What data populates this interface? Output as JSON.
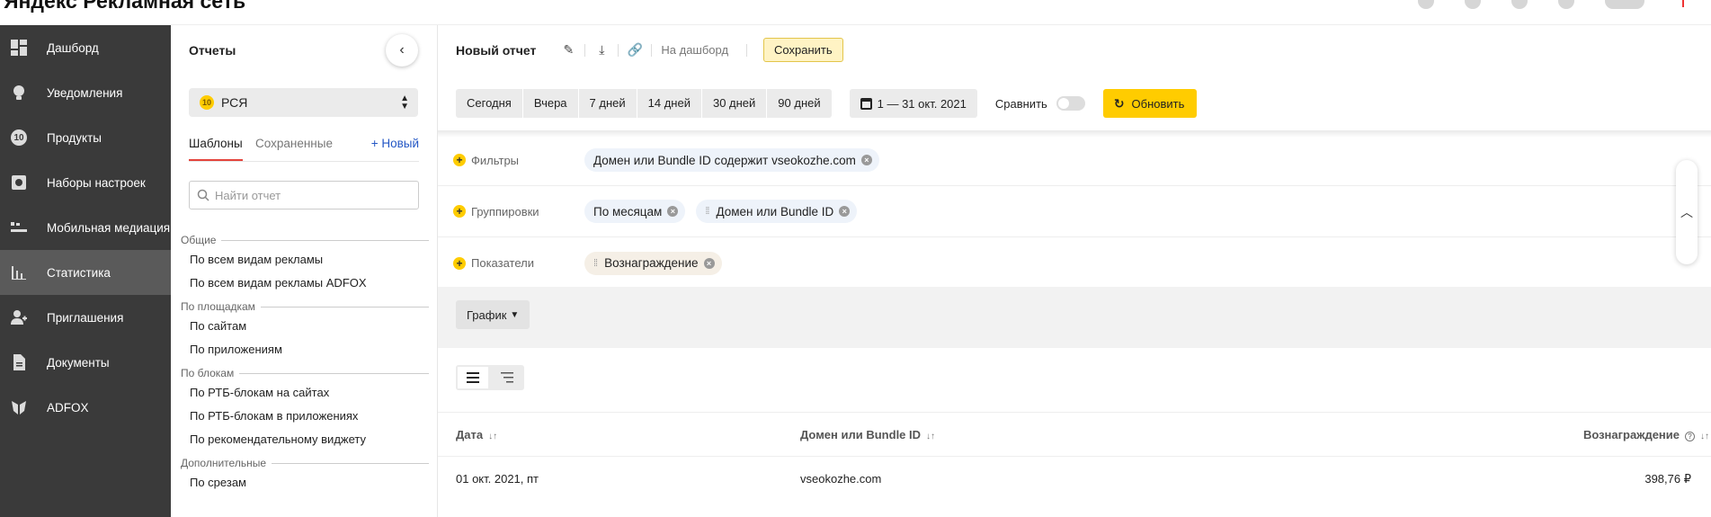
{
  "header": {
    "brand": "Яндекс Рекламная сеть"
  },
  "nav": {
    "items": [
      {
        "label": "Дашборд",
        "icon": "dashboard-icon"
      },
      {
        "label": "Уведомления",
        "icon": "bulb-icon"
      },
      {
        "label": "Продукты",
        "icon": "products-icon",
        "badge": "10"
      },
      {
        "label": "Наборы настроек",
        "icon": "settings-icon"
      },
      {
        "label": "Мобильная медиация",
        "icon": "mediation-icon"
      },
      {
        "label": "Статистика",
        "icon": "statistics-icon",
        "active": true
      },
      {
        "label": "Приглашения",
        "icon": "invite-icon"
      },
      {
        "label": "Документы",
        "icon": "documents-icon"
      },
      {
        "label": "ADFOX",
        "icon": "adfox-icon"
      }
    ]
  },
  "reports": {
    "title": "Отчеты",
    "select": {
      "value": "РСЯ",
      "badge": "10"
    },
    "tabs": {
      "templates": "Шаблоны",
      "saved": "Сохраненные",
      "new": "+ Новый"
    },
    "search": {
      "placeholder": "Найти отчет"
    },
    "groups": [
      {
        "title": "Общие",
        "items": [
          "По всем видам рекламы",
          "По всем видам рекламы ADFOX"
        ]
      },
      {
        "title": "По площадкам",
        "items": [
          "По сайтам",
          "По приложениям"
        ]
      },
      {
        "title": "По блокам",
        "items": [
          "По РТБ-блокам на сайтах",
          "По РТБ-блокам в приложениях",
          "По рекомендательному виджету"
        ]
      },
      {
        "title": "Дополнительные",
        "items": [
          "По срезам"
        ]
      }
    ]
  },
  "toolbar": {
    "title": "Новый отчет",
    "to_dashboard": "На дашборд",
    "save": "Сохранить"
  },
  "periods": {
    "buttons": [
      "Сегодня",
      "Вчера",
      "7 дней",
      "14 дней",
      "30 дней",
      "90 дней"
    ],
    "date_range": "1 — 31 окт. 2021",
    "compare": "Сравнить",
    "refresh": "Обновить"
  },
  "filters": {
    "filters_label": "Фильтры",
    "filter_chip_prefix": "Домен или Bundle ID содержит",
    "filter_chip_value": "vseokozhe.com",
    "groupings_label": "Группировки",
    "grouping_chips": [
      "По месяцам",
      "Домен или Bundle ID"
    ],
    "metrics_label": "Показатели",
    "metric_chips": [
      "Вознаграждение"
    ]
  },
  "graph": {
    "label": "График"
  },
  "table": {
    "columns": [
      "Дата",
      "Домен или Bundle ID",
      "Вознаграждение"
    ],
    "rows": [
      {
        "date": "01 окт. 2021, пт",
        "domain": "vseokozhe.com",
        "reward": "398,76 ₽"
      }
    ]
  }
}
